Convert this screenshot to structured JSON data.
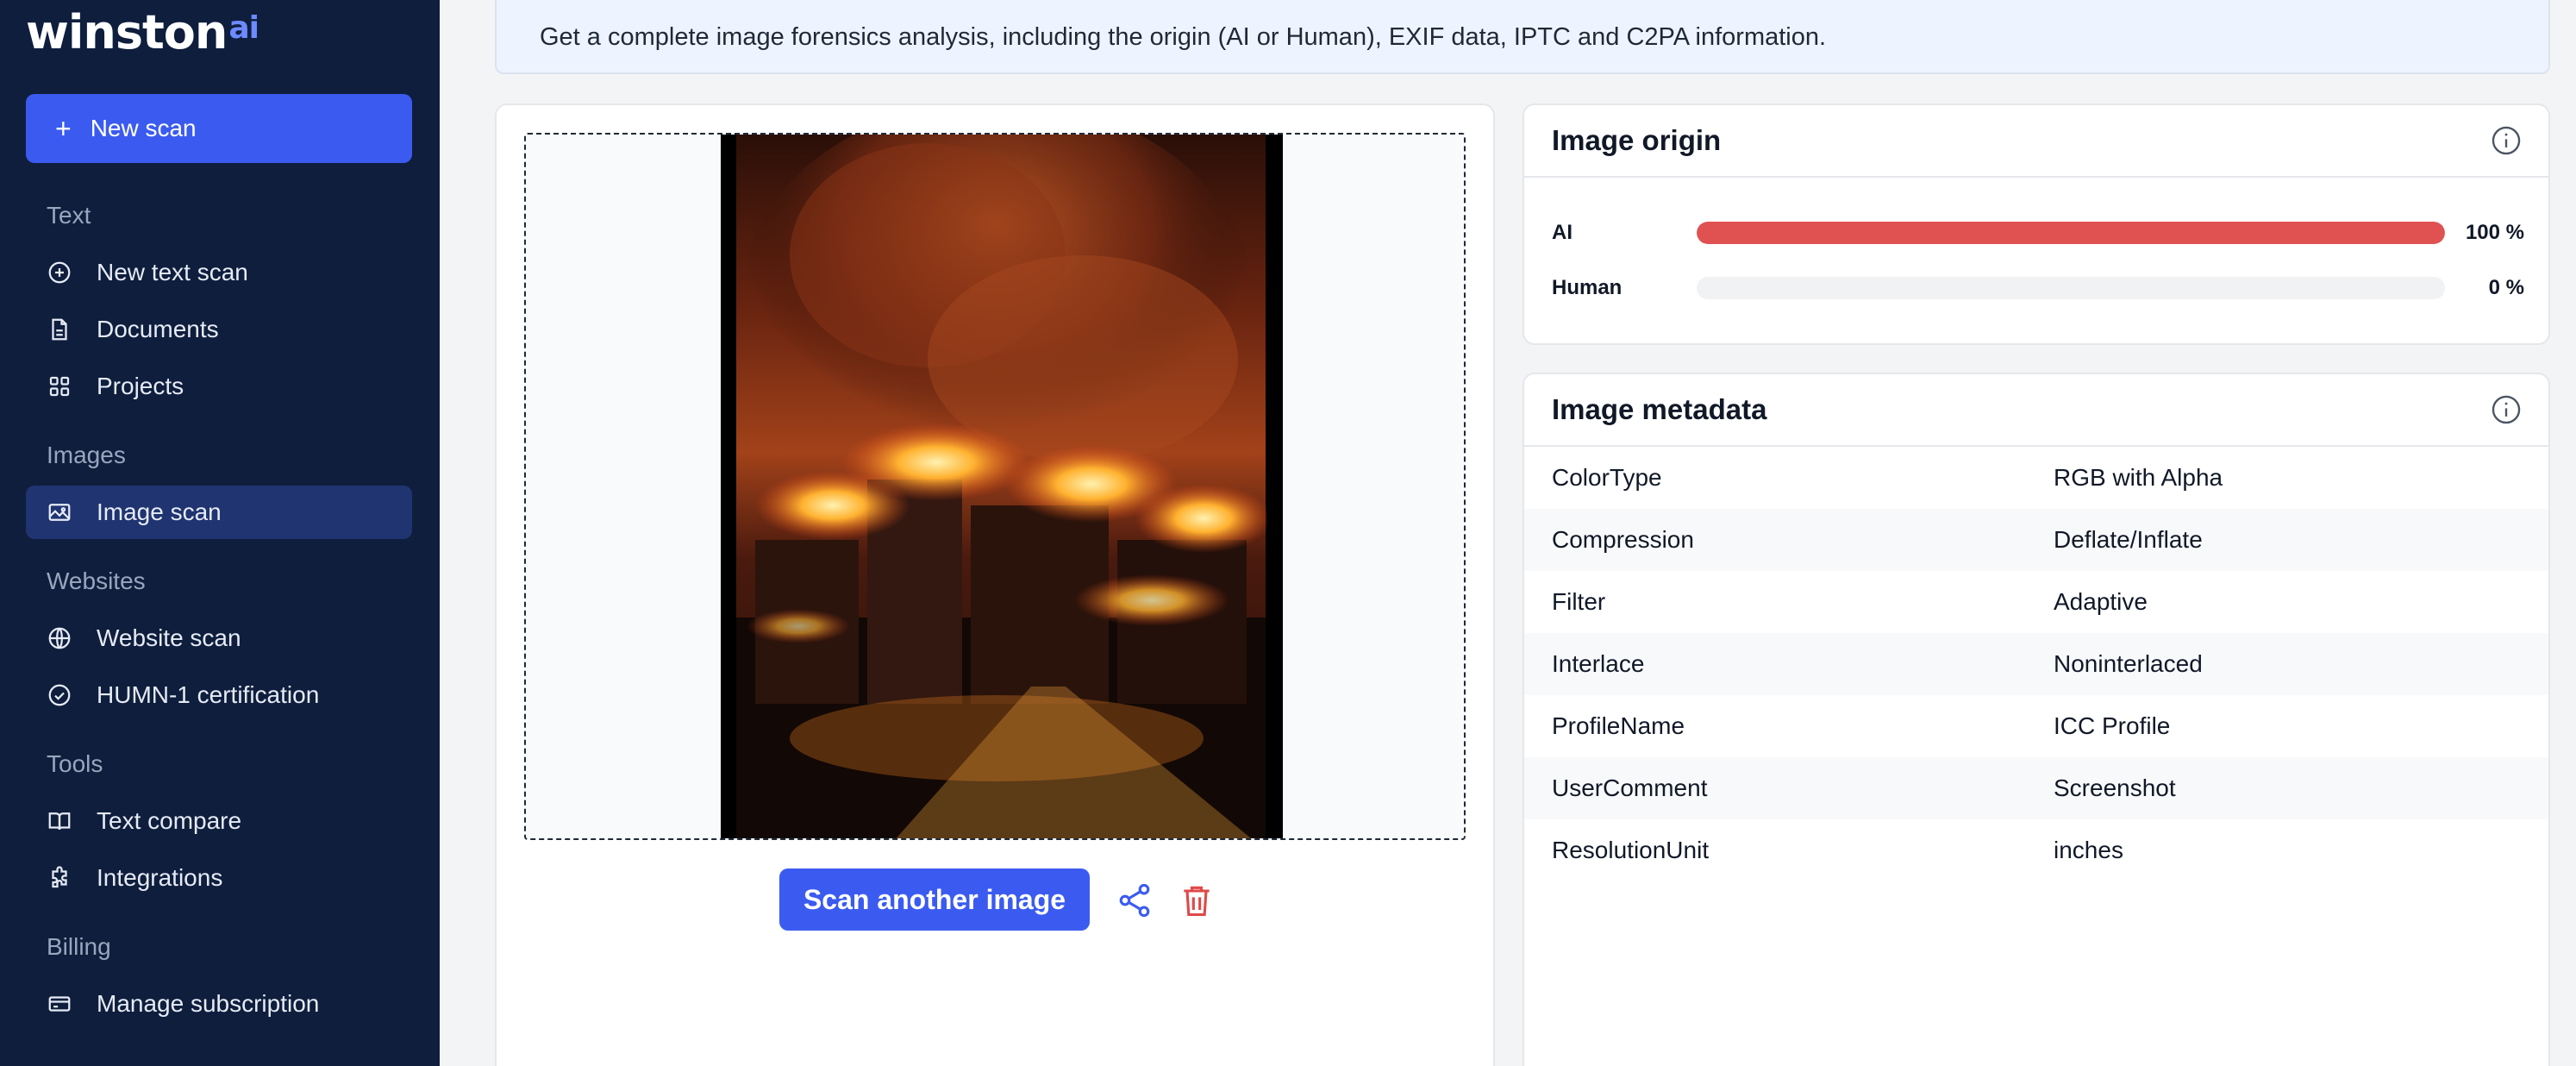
{
  "brand": {
    "name": "winston",
    "suffix": "ai"
  },
  "sidebar": {
    "new_scan_label": "New scan",
    "sections": {
      "text": "Text",
      "images": "Images",
      "websites": "Websites",
      "tools": "Tools",
      "billing": "Billing"
    },
    "items": [
      {
        "label": "New text scan",
        "icon": "plus-circle-icon"
      },
      {
        "label": "Documents",
        "icon": "document-icon"
      },
      {
        "label": "Projects",
        "icon": "grid-icon"
      },
      {
        "label": "Image scan",
        "icon": "image-icon",
        "active": true
      },
      {
        "label": "Website scan",
        "icon": "globe-icon"
      },
      {
        "label": "HUMN-1 certification",
        "icon": "check-circle-icon"
      },
      {
        "label": "Text compare",
        "icon": "book-icon"
      },
      {
        "label": "Integrations",
        "icon": "puzzle-icon"
      },
      {
        "label": "Manage subscription",
        "icon": "card-icon"
      }
    ]
  },
  "banner": {
    "text": "Get a complete image forensics analysis, including the origin (AI or Human), EXIF data, IPTC and C2PA information."
  },
  "image_panel": {
    "scan_another_label": "Scan another image"
  },
  "origin": {
    "title": "Image origin",
    "rows": [
      {
        "label": "AI",
        "value": "100 %",
        "fraction": 1.0
      },
      {
        "label": "Human",
        "value": "0 %",
        "fraction": 0.0
      }
    ]
  },
  "metadata": {
    "title": "Image metadata",
    "rows": [
      {
        "key": "ColorType",
        "value": "RGB with Alpha"
      },
      {
        "key": "Compression",
        "value": "Deflate/Inflate"
      },
      {
        "key": "Filter",
        "value": "Adaptive"
      },
      {
        "key": "Interlace",
        "value": "Noninterlaced"
      },
      {
        "key": "ProfileName",
        "value": "ICC Profile"
      },
      {
        "key": "UserComment",
        "value": "Screenshot"
      },
      {
        "key": "ResolutionUnit",
        "value": "inches"
      }
    ]
  },
  "colors": {
    "accent": "#3b5bf0",
    "sidebar_bg": "#0f1e3d",
    "ai_bar": "#e05252",
    "danger": "#e04848"
  }
}
